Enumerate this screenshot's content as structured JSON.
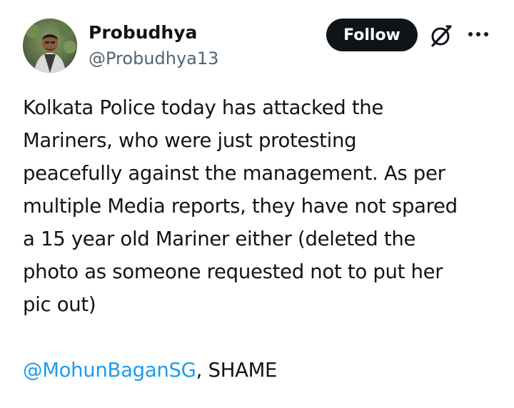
{
  "author": {
    "display_name": "Probudhya",
    "handle": "@Probudhya13"
  },
  "actions": {
    "follow_label": "Follow",
    "grok_icon": "grok-icon",
    "more_icon": "more-options-icon"
  },
  "tweet": {
    "lines": [
      "Kolkata Police today has attacked the",
      "Mariners, who were just protesting",
      "peacefully against the management. As per",
      "multiple Media reports, they have not spared",
      "a 15 year old Mariner either (deleted the",
      "photo as someone requested not to put her",
      "pic out)"
    ],
    "mention": "@MohunBaganSG",
    "mention_suffix": ", SHAME"
  },
  "colors": {
    "text": "#0f1419",
    "secondary": "#536471",
    "link": "#1d9bf0",
    "button_bg": "#0f1419"
  }
}
